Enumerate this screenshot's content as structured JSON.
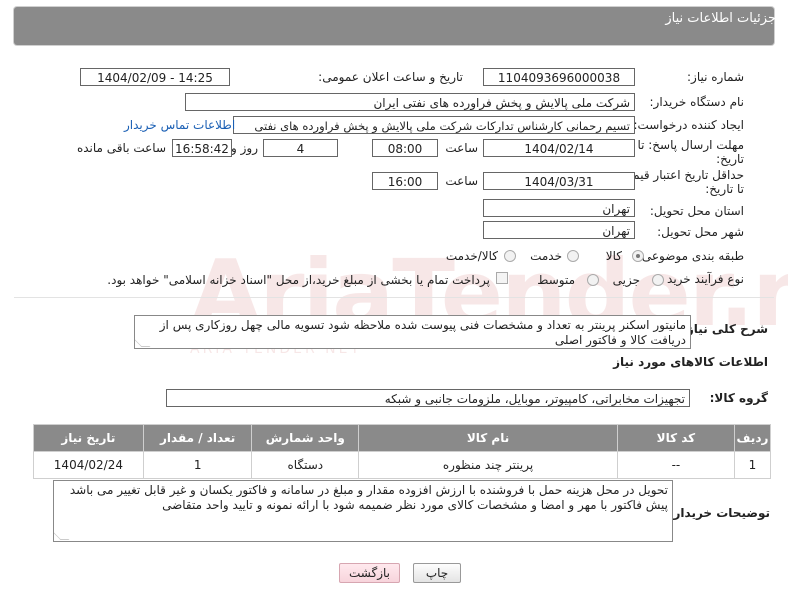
{
  "header": {
    "title": "جزئیات اطلاعات نیاز"
  },
  "fields": {
    "need_number_label": "شماره نیاز:",
    "need_number": "1104093696000038",
    "announce_label": "تاریخ و ساعت اعلان عمومی:",
    "announce_value": "1404/02/09 - 14:25",
    "buyer_org_label": "نام دستگاه خریدار:",
    "buyer_org": "شرکت ملی پالایش و پخش فراورده های نفتی ایران",
    "requester_label": "ایجاد کننده درخواست:",
    "requester": "تسیم رحمانی کارشناس تدارکات شرکت ملی پالایش و پخش فراورده های نفتی",
    "contact_link": "اطلاعات تماس خریدار",
    "deadline_label_1": "مهلت ارسال پاسخ: تا",
    "deadline_label_2": "تاریخ:",
    "deadline_date": "1404/02/14",
    "time_word": "ساعت",
    "deadline_time": "08:00",
    "days_value": "4",
    "days_word": "روز و",
    "remaining_time": "16:58:42",
    "remaining_word": "ساعت باقی مانده",
    "validity_label_1": "حداقل تاریخ اعتبار قیمت:",
    "validity_label_2": "تا تاریخ:",
    "validity_date": "1404/03/31",
    "validity_time": "16:00",
    "province_label": "استان محل تحویل:",
    "province": "تهران",
    "city_label": "شهر محل تحویل:",
    "city": "تهران",
    "category_label": "طبقه بندی موضوعی:",
    "category_options": [
      "کالا",
      "خدمت",
      "کالا/خدمت"
    ],
    "category_selected": "کالا",
    "process_label": "نوع فرآیند خرید :",
    "process_options": [
      "جزیی",
      "متوسط"
    ],
    "payment_note": "پرداخت تمام یا بخشی از مبلغ خرید،از محل \"اسناد خزانه اسلامی\" خواهد بود."
  },
  "summary": {
    "label": "شرح کلی نیاز:",
    "text": "مانیتور اسکنر پرینتر به تعداد و مشخصات فنی  پیوست شده ملاحظه شود   تسویه مالی چهل روزکاری پس از دریافت کالا و فاکتور اصلی"
  },
  "goods": {
    "section_title": "اطلاعات کالاهای مورد نیاز",
    "group_label": "گروه کالا:",
    "group_value": "تجهیزات مخابراتی، کامپیوتر، موبایل، ملزومات جانبی و شبکه",
    "columns": [
      "ردیف",
      "کد کالا",
      "نام کالا",
      "واحد شمارش",
      "تعداد / مقدار",
      "تاریخ نیاز"
    ],
    "rows": [
      [
        "1",
        "--",
        "پرینتر چند منظوره",
        "دستگاه",
        "1",
        "1404/02/24"
      ]
    ]
  },
  "buyer_notes": {
    "label": "توضیحات خریدار:",
    "text": "تحویل در محل هزینه حمل با فروشنده با ارزش افزوده مقدار و مبلغ در سامانه و فاکتور یکسان و غیر قابل تغییر می باشد پیش فاکتور با مهر و امضا و مشخصات کالای مورد نظر ضمیمه شود با ارائه نمونه و تایید واحد متقاضی"
  },
  "buttons": {
    "print": "چاپ",
    "back": "بازگشت"
  },
  "watermark": {
    "text": "AriaTender.neT",
    "sub": "ARIA TENDER NET"
  },
  "colors": {
    "header": "#8a8a8a",
    "link": "#1a5fb4",
    "watermark": "#b40000"
  }
}
